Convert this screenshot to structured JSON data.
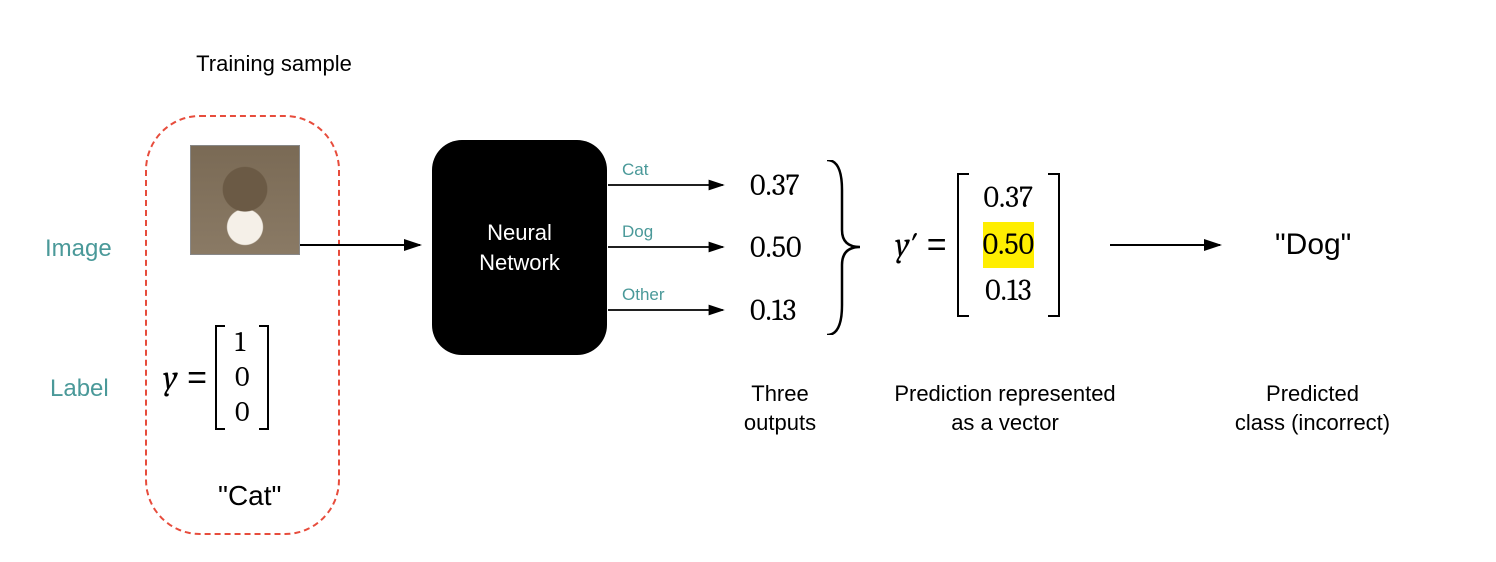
{
  "labels": {
    "training_sample": "Training sample",
    "image": "Image",
    "label": "Label",
    "three_outputs": "Three\noutputs",
    "pred_vector": "Prediction represented\nas a vector",
    "pred_class": "Predicted\nclass (incorrect)"
  },
  "nn_box": "Neural\nNetwork",
  "output_classes": [
    "Cat",
    "Dog",
    "Other"
  ],
  "output_values": [
    "0.37",
    "0.50",
    "0.13"
  ],
  "y_true": {
    "var": "y",
    "op": "=",
    "values": [
      "1",
      "0",
      "0"
    ]
  },
  "y_true_class": "\"Cat\"",
  "y_pred": {
    "var": "y′",
    "op": "=",
    "values": [
      "0.37",
      "0.50",
      "0.13"
    ],
    "highlight_index": 1
  },
  "predicted_class": "\"Dog\""
}
